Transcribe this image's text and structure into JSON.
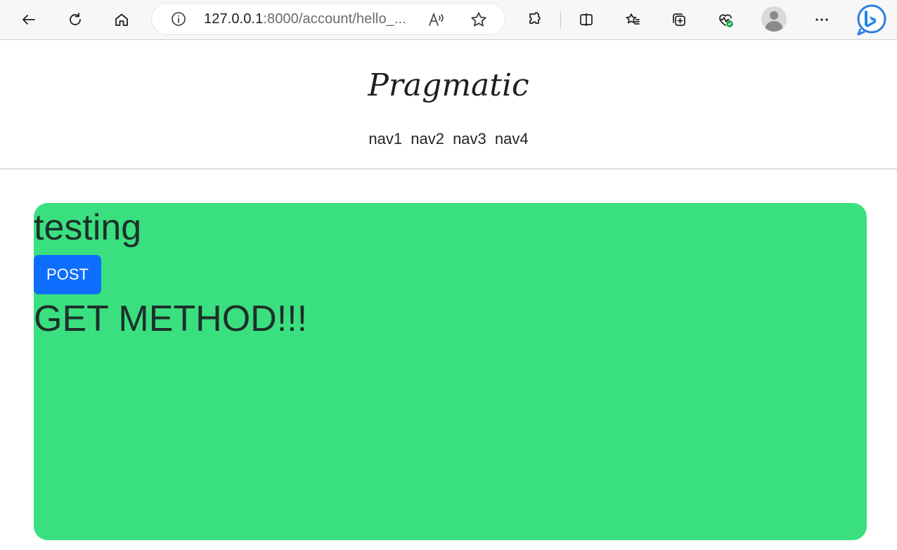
{
  "browser": {
    "url_host": "127.0.0.1",
    "url_rest": ":8000/account/hello_..."
  },
  "page": {
    "site_title": "Pragmatic",
    "nav": [
      "nav1",
      "nav2",
      "nav3",
      "nav4"
    ],
    "card": {
      "title": "testing",
      "button_label": "POST",
      "result_text": "GET METHOD!!!",
      "background_color": "#3ae080",
      "button_color": "#0d6efd"
    }
  },
  "icons": [
    "back-icon",
    "refresh-icon",
    "home-icon",
    "info-icon",
    "read-aloud-icon",
    "favorite-star-icon",
    "extensions-icon",
    "split-screen-icon",
    "favorites-icon",
    "collections-icon",
    "browser-essentials-icon",
    "profile-avatar",
    "more-icon",
    "bing-icon"
  ]
}
